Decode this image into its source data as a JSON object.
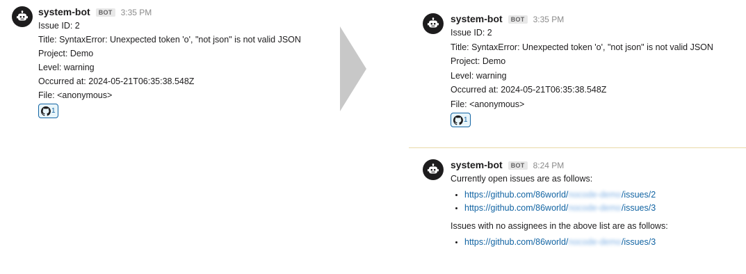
{
  "left": {
    "message": {
      "username": "system-bot",
      "badge": "BOT",
      "time": "3:35 PM",
      "lines": {
        "issue_id": "Issue ID: 2",
        "title": "Title: SyntaxError: Unexpected token 'o', \"not json\" is not valid JSON",
        "project": "Project: Demo",
        "level": "Level: warning",
        "occurred": "Occurred at: 2024-05-21T06:35:38.548Z",
        "file": "File: <anonymous>"
      },
      "reaction": {
        "icon": "github-icon",
        "count": "1"
      }
    }
  },
  "right": {
    "message1": {
      "username": "system-bot",
      "badge": "BOT",
      "time": "3:35 PM",
      "lines": {
        "issue_id": "Issue ID: 2",
        "title": "Title: SyntaxError: Unexpected token 'o', \"not json\" is not valid JSON",
        "project": "Project: Demo",
        "level": "Level: warning",
        "occurred": "Occurred at: 2024-05-21T06:35:38.548Z",
        "file": "File: <anonymous>"
      },
      "reaction": {
        "icon": "github-icon",
        "count": "1"
      }
    },
    "message2": {
      "username": "system-bot",
      "badge": "BOT",
      "time": "8:24 PM",
      "intro": "Currently open issues are as follows:",
      "open_links": [
        {
          "prefix": "https://github.com/86world/",
          "blurred": "nocode-demo",
          "suffix": "/issues/2"
        },
        {
          "prefix": "https://github.com/86world/",
          "blurred": "nocode-demo",
          "suffix": "/issues/3"
        }
      ],
      "no_assignee_intro": "Issues with no assignees in the above list are as follows:",
      "no_assignee_links": [
        {
          "prefix": "https://github.com/86world/",
          "blurred": "nocode-demo",
          "suffix": "/issues/3"
        }
      ]
    }
  },
  "colors": {
    "link": "#1264a3",
    "divider": "#e8d9a8",
    "arrow": "#c8c8c8",
    "avatar": "#1d1c1d"
  }
}
